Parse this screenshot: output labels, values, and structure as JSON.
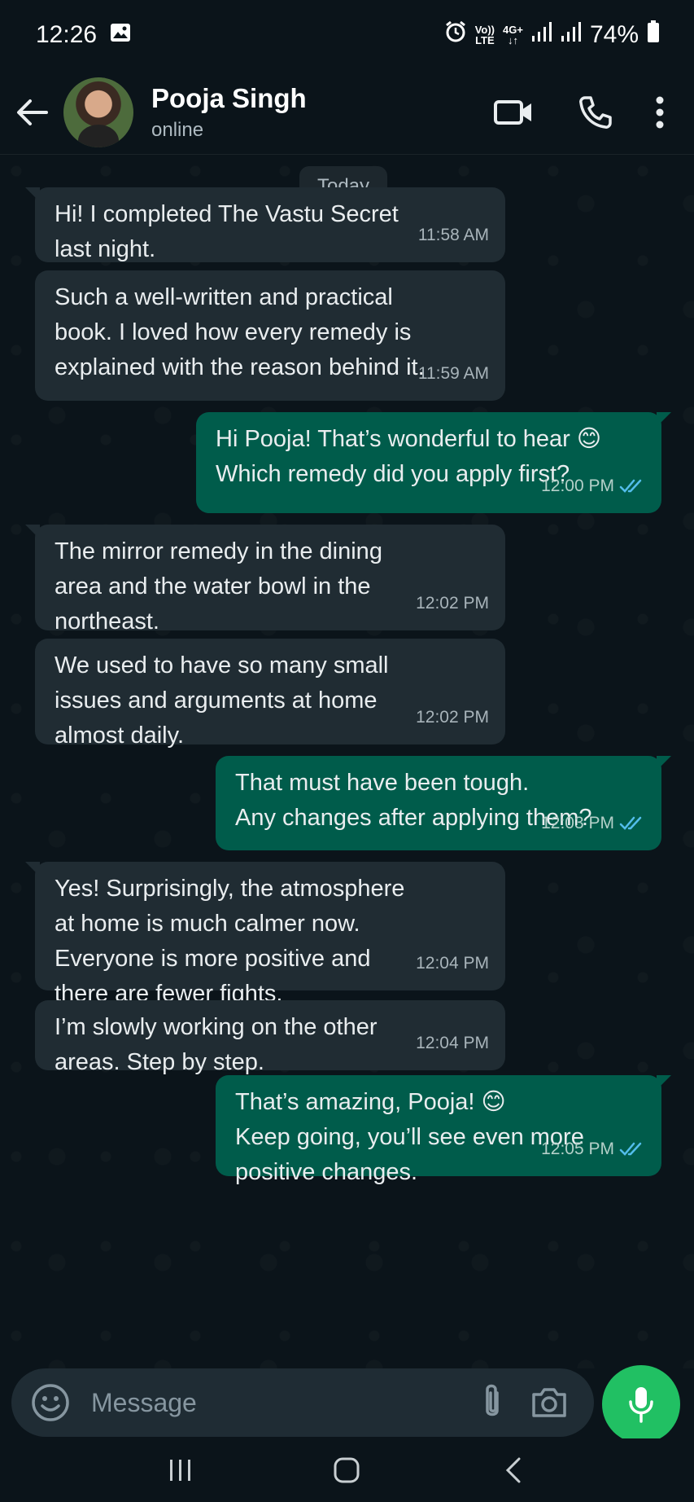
{
  "status_bar": {
    "time": "12:26",
    "volte_top": "Vo))",
    "volte_bottom": "LTE",
    "network_top": "4G+",
    "network_bottom": "↓↑",
    "battery": "74%"
  },
  "header": {
    "contact_name": "Pooja Singh",
    "contact_status": "online"
  },
  "chat": {
    "date_chip": "Today",
    "messages": [
      {
        "dir": "in",
        "text": "Hi! I completed The Vastu Secret\nlast night.",
        "time": "11:58 AM"
      },
      {
        "dir": "in",
        "text": "Such a well-written and practical\nbook. I loved how every remedy is\nexplained with the reason behind it.",
        "time": "11:59 AM"
      },
      {
        "dir": "out",
        "text": "Hi Pooja! That’s wonderful to hear 😊\nWhich remedy did you apply first?",
        "time": "12:00 PM"
      },
      {
        "dir": "in",
        "text": "The mirror remedy in the dining\narea and the water bowl in the\nnortheast.",
        "time": "12:02 PM"
      },
      {
        "dir": "in",
        "text": "We used to have so many small\nissues and arguments at home\nalmost daily.",
        "time": "12:02 PM"
      },
      {
        "dir": "out",
        "text": "That must have been tough.\nAny changes after applying them?",
        "time": "12:03 PM"
      },
      {
        "dir": "in",
        "text": "Yes! Surprisingly, the atmosphere\nat home is much calmer now.\nEveryone is more positive and\nthere are fewer fights.",
        "time": "12:04 PM"
      },
      {
        "dir": "in",
        "text": "I’m slowly working on the other\nareas. Step by step.",
        "time": "12:04 PM"
      },
      {
        "dir": "out",
        "text": "That’s amazing, Pooja! 😊\nKeep going, you’ll see even more\npositive changes.",
        "time": "12:05 PM"
      }
    ]
  },
  "input": {
    "placeholder": "Message"
  },
  "colors": {
    "background": "#0b141a",
    "incoming_bubble": "#202c33",
    "outgoing_bubble": "#005c4b",
    "read_ticks": "#53bdeb",
    "mic_button": "#21c063"
  }
}
